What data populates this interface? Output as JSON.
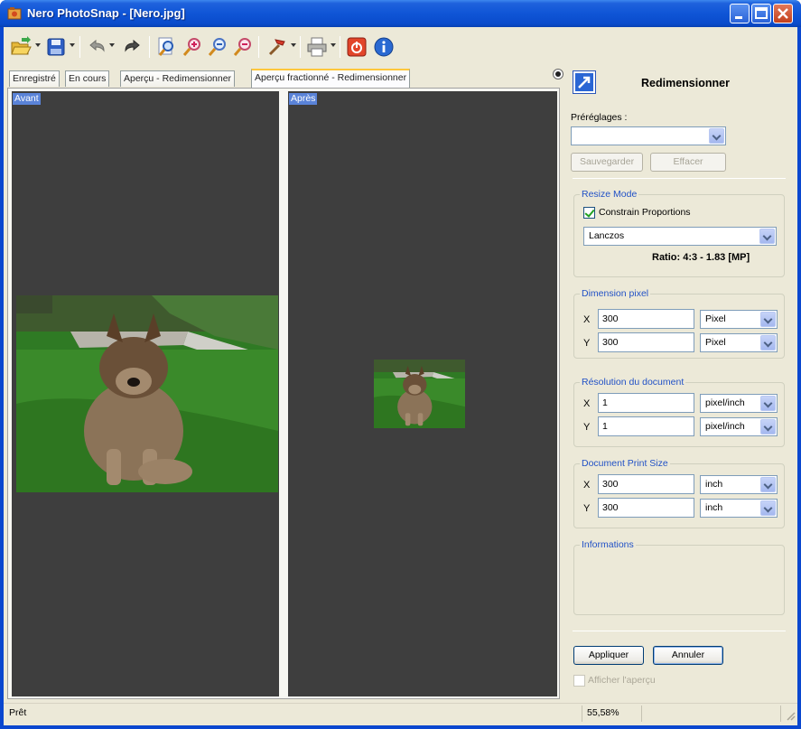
{
  "window": {
    "title": "Nero PhotoSnap - [Nero.jpg]"
  },
  "toolbar": {
    "tools": [
      "open-icon",
      "save-icon",
      "undo-icon",
      "redo-icon",
      "zoom-fit-icon",
      "zoom-in-icon",
      "zoom-out-icon",
      "zoom-actual-icon",
      "tools-icon",
      "print-icon",
      "exit-icon",
      "info-icon"
    ]
  },
  "tabs": [
    {
      "label": "Enregistré"
    },
    {
      "label": "En cours"
    },
    {
      "label": "Aperçu - Redimensionner"
    },
    {
      "label": "Aperçu fractionné - Redimensionner"
    }
  ],
  "preview": {
    "before_label": "Avant",
    "after_label": "Après"
  },
  "side": {
    "title": "Redimensionner",
    "presets_label": "Préréglages :",
    "presets_value": "",
    "save_button": "Sauvegarder",
    "delete_button": "Effacer",
    "resize_mode": {
      "title": "Resize Mode",
      "constrain_label": "Constrain Proportions",
      "constrain_checked": true,
      "method_value": "Lanczos",
      "ratio_text": "Ratio: 4:3 - 1.83 [MP]"
    },
    "pixel_dimension": {
      "title": "Dimension pixel",
      "x_label": "X",
      "x_value": "300",
      "x_unit": "Pixel",
      "y_label": "Y",
      "y_value": "300",
      "y_unit": "Pixel"
    },
    "resolution": {
      "title": "Résolution du document",
      "x_label": "X",
      "x_value": "1",
      "x_unit": "pixel/inch",
      "y_label": "Y",
      "y_value": "1",
      "y_unit": "pixel/inch"
    },
    "print_size": {
      "title": "Document Print Size",
      "x_label": "X",
      "x_value": "300",
      "x_unit": "inch",
      "y_label": "Y",
      "y_value": "300",
      "y_unit": "inch"
    },
    "information": {
      "title": "Informations"
    },
    "apply_button": "Appliquer",
    "cancel_button": "Annuler",
    "show_preview_label": "Afficher l'aperçu",
    "show_preview_checked": false
  },
  "statusbar": {
    "status": "Prêt",
    "zoom": "55,58%"
  },
  "colors": {
    "titlebar": "#0f55d6",
    "pane_bg": "#3e3e3e",
    "group_title": "#2151c6",
    "label_highlight": "#5a83d8"
  }
}
